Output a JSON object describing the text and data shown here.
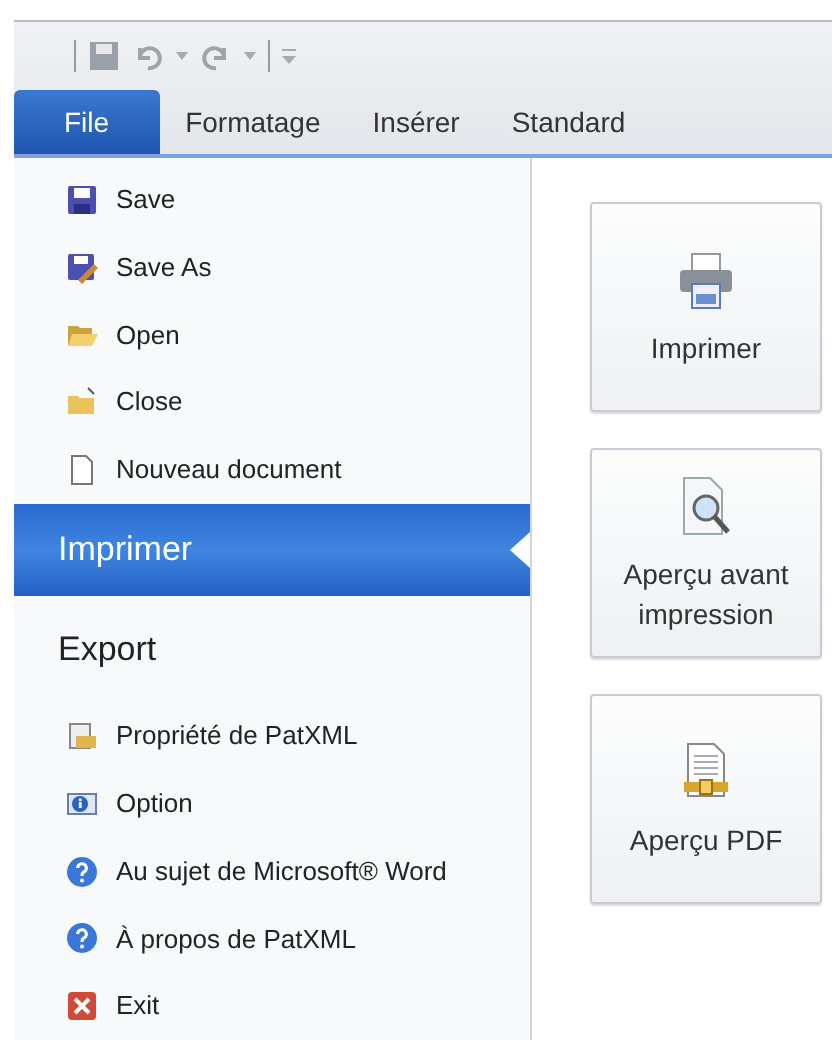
{
  "ribbon_tabs": [
    {
      "label": "File",
      "selected": true
    },
    {
      "label": "Formatage",
      "selected": false
    },
    {
      "label": "Insérer",
      "selected": false
    },
    {
      "label": "Standard",
      "selected": false
    }
  ],
  "menu_items": [
    {
      "kind": "command",
      "label": "Save",
      "selected": false
    },
    {
      "kind": "command",
      "label": "Save As",
      "selected": false
    },
    {
      "kind": "command",
      "label": "Open",
      "selected": false
    },
    {
      "kind": "command",
      "label": "Close",
      "selected": false
    },
    {
      "kind": "command",
      "label": "Nouveau document",
      "selected": false
    },
    {
      "kind": "section",
      "label": "Imprimer",
      "selected": true
    },
    {
      "kind": "section",
      "label": "Export",
      "selected": false
    },
    {
      "kind": "command",
      "label": "Propriété de PatXML",
      "selected": false
    },
    {
      "kind": "command",
      "label": "Option",
      "selected": false
    },
    {
      "kind": "command",
      "label": "Au sujet de Microsoft® Word",
      "selected": false
    },
    {
      "kind": "command",
      "label": "À propos de PatXML",
      "selected": false
    },
    {
      "kind": "command",
      "label": "Exit",
      "selected": false
    }
  ],
  "print_buttons": [
    {
      "label": "Imprimer"
    },
    {
      "label": "Aperçu avant impression"
    },
    {
      "label": "Aperçu PDF"
    }
  ]
}
